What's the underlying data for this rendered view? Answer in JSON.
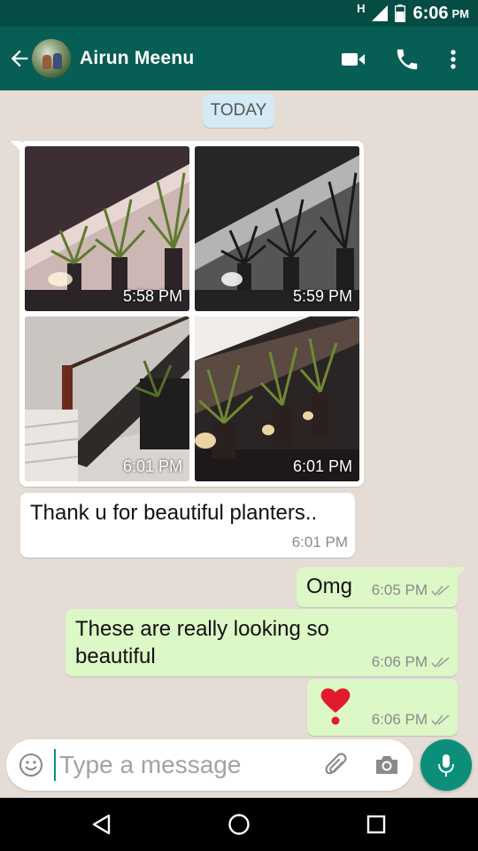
{
  "status_bar": {
    "network_label": "H",
    "time": "6:06",
    "ampm": "PM",
    "icons": [
      "signal-icon",
      "battery-icon"
    ]
  },
  "toolbar": {
    "contact_name": "Airun Meenu",
    "icons": [
      "back-arrow-icon",
      "avatar",
      "video-call-icon",
      "voice-call-icon",
      "more-options-icon"
    ]
  },
  "chat": {
    "date_label": "TODAY",
    "photo_message": {
      "photos": [
        {
          "time": "5:58 PM"
        },
        {
          "time": "5:59 PM"
        },
        {
          "time": "6:01 PM"
        },
        {
          "time": "6:01 PM"
        }
      ]
    },
    "messages": [
      {
        "direction": "in",
        "text": "Thank u for beautiful planters..",
        "time": "6:01 PM"
      },
      {
        "direction": "out",
        "text": "Omg",
        "time": "6:05 PM",
        "status": "read"
      },
      {
        "direction": "out",
        "text_line1": "These are really looking so",
        "text_line2": "beautiful",
        "time": "6:06 PM",
        "status": "read"
      },
      {
        "direction": "out",
        "emoji": "heavy-heart-exclamation",
        "time": "6:06 PM",
        "status": "read"
      }
    ]
  },
  "composer": {
    "placeholder": "Type a message",
    "icons": [
      "emoji-icon",
      "attach-icon",
      "camera-icon",
      "mic-icon"
    ]
  },
  "nav_bar": {
    "icons": [
      "back-triangle-icon",
      "home-circle-icon",
      "recents-square-icon"
    ]
  },
  "colors": {
    "header": "#075e54",
    "status_bar": "#054d44",
    "chat_bg": "#e5ddd5",
    "outgoing_bubble": "#dcf8c6",
    "incoming_bubble": "#ffffff",
    "accent": "#0b8f7a",
    "date_chip": "#d4eaf4"
  }
}
